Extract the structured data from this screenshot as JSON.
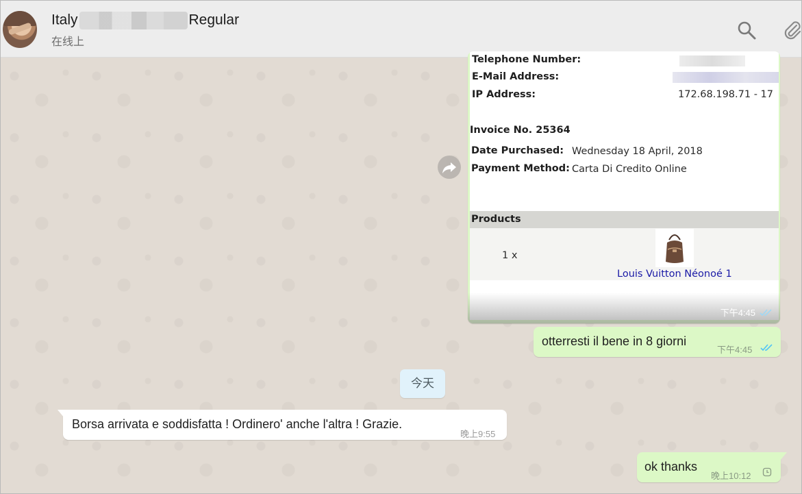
{
  "header": {
    "contact_name_prefix": "Italy",
    "contact_name_suffix": "Regular",
    "status": "在线上"
  },
  "invoice_card": {
    "telephone_label": "Telephone Number:",
    "email_label": "E-Mail Address:",
    "ip_label": "IP Address:",
    "ip_value": "172.68.198.71 - 17",
    "invoice_label": "Invoice No. 25364",
    "date_label": "Date Purchased:",
    "date_value": "Wednesday 18 April, 2018",
    "payment_label": "Payment Method:",
    "payment_value": "Carta Di Credito Online",
    "products_header": "Products",
    "quantity": "1 x",
    "product_name": "Louis Vuitton Néonoé 1",
    "time": "下午4:45"
  },
  "messages": [
    {
      "text": "otterresti il bene in 8 giorni",
      "time": "下午4:45"
    },
    {
      "text": "Borsa arrivata e soddisfatta ! Ordinero' anche l'altra ! Grazie.",
      "time": "晚上9:55"
    },
    {
      "text": "ok thanks",
      "time": "晚上10:12"
    }
  ],
  "day_divider": "今天",
  "colors": {
    "outgoing_bubble": "#dcf8c6",
    "incoming_bubble": "#ffffff",
    "read_ticks": "#4fc3f7",
    "product_link": "#1a1aa6"
  }
}
